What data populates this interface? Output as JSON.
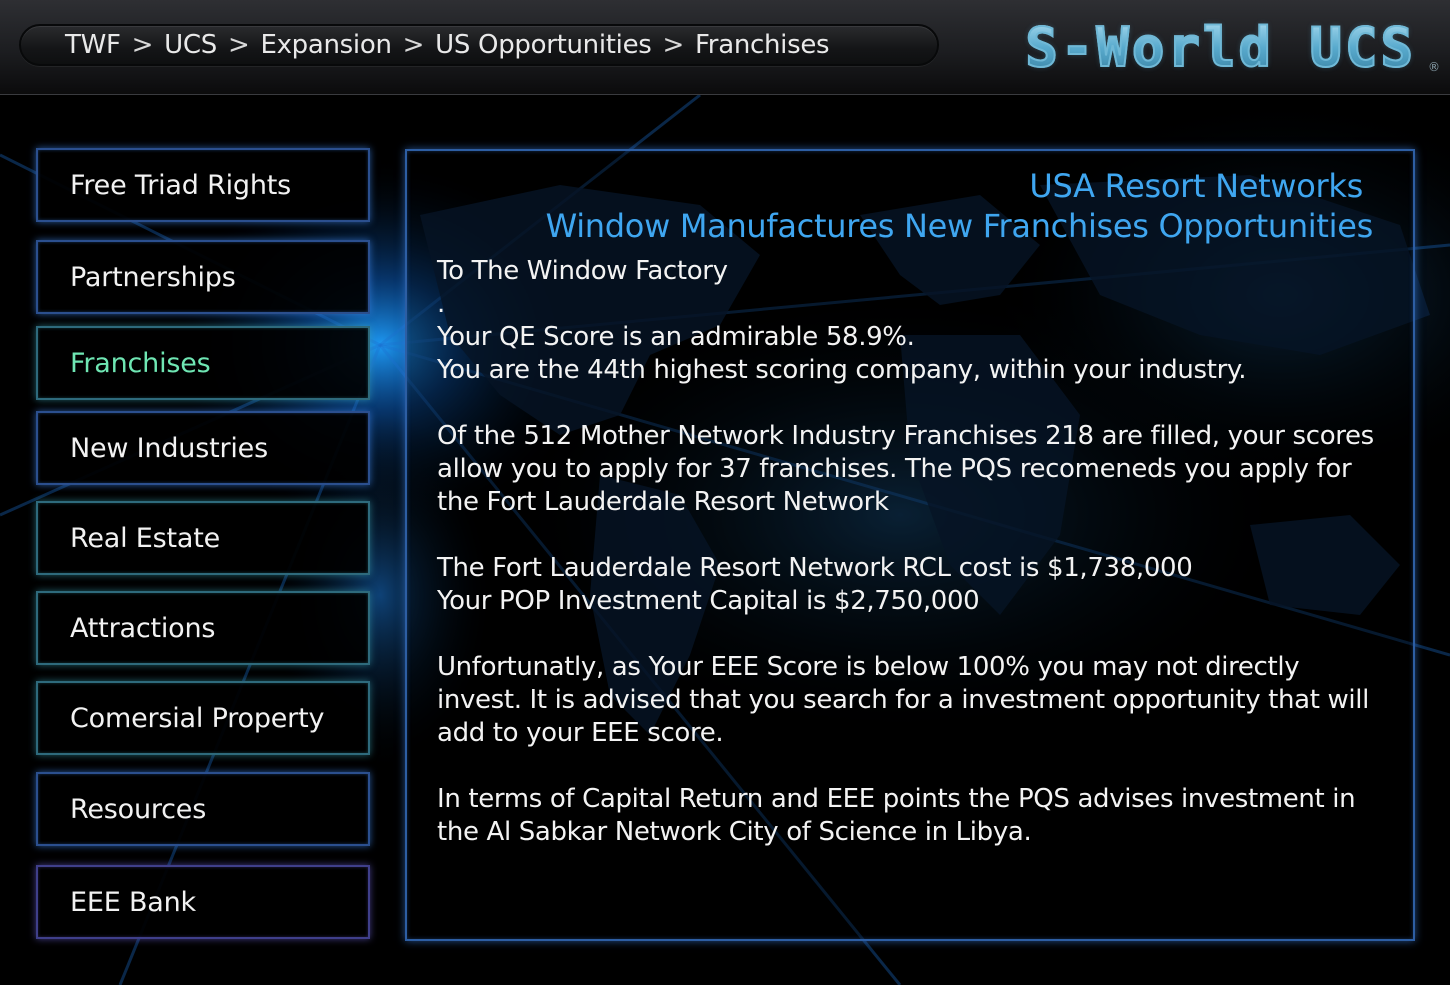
{
  "breadcrumb": {
    "items": [
      "TWF",
      "UCS",
      "Expansion",
      "US Opportunities",
      "Franchises"
    ],
    "separator": ">"
  },
  "logo": {
    "text": "S-World UCS",
    "reg_mark": "®"
  },
  "sidebar": {
    "items": [
      {
        "label": "Free Triad Rights"
      },
      {
        "label": "Partnerships"
      },
      {
        "label": "Franchises"
      },
      {
        "label": "New Industries"
      },
      {
        "label": "Real Estate"
      },
      {
        "label": "Attractions"
      },
      {
        "label": "Comersial Property"
      },
      {
        "label": "Resources"
      },
      {
        "label": "EEE Bank"
      }
    ],
    "active_index": 2
  },
  "panel": {
    "title": "USA Resort Networks",
    "subtitle": "Window Manufactures New Franchises Opportunities",
    "greeting": "To The Window Factory",
    "dot": ".",
    "qe_score_line": "Your QE Score is an admirable 58.9%.",
    "rank_line": "You are the 44th highest scoring company, within your industry.",
    "franchise_para": "Of the 512 Mother Network Industry Franchises 218 are filled, your scores allow you to apply for 37 franchises. The PQS recomeneds you apply for the Fort Lauderdale Resort Network",
    "rcl_line": "The Fort Lauderdale Resort Network RCL cost is $1,738,000",
    "pop_line": "Your POP Investment Capital is $2,750,000",
    "eee_para": "Unfortunatly, as Your EEE Score is below 100% you may not directly invest. It is advised that you search for a investment opportunity that will add to your EEE score.",
    "advice_para": "In terms of Capital Return and EEE points the PQS advises investment in the Al Sabkar Network City of Science in Libya."
  },
  "colors": {
    "accent_blue": "#3fa6f0",
    "active_nav": "#6fe6b3",
    "border_blue": "#2d5ea3"
  }
}
